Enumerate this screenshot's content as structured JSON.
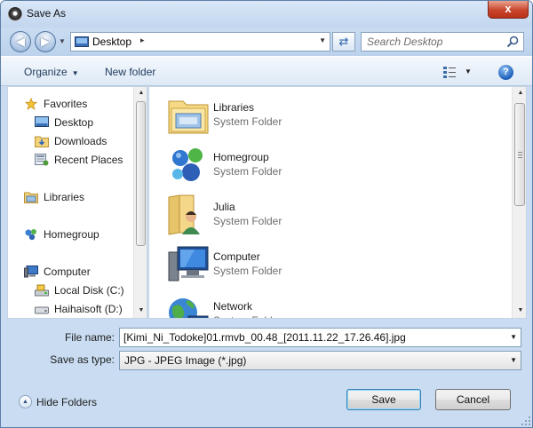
{
  "window": {
    "title": "Save As",
    "close_label": "x"
  },
  "address": {
    "location": "Desktop",
    "separator": "▸",
    "search_placeholder": "Search Desktop"
  },
  "toolbar": {
    "organize_label": "Organize",
    "new_folder_label": "New folder",
    "help_label": "?"
  },
  "navigation": {
    "favorites": {
      "label": "Favorites",
      "items": [
        "Desktop",
        "Downloads",
        "Recent Places"
      ]
    },
    "libraries": {
      "label": "Libraries"
    },
    "homegroup": {
      "label": "Homegroup"
    },
    "computer": {
      "label": "Computer",
      "items": [
        "Local Disk (C:)",
        "Haihaisoft (D:)"
      ]
    }
  },
  "content": {
    "items": [
      {
        "name": "Libraries",
        "type": "System Folder",
        "icon": "libraries-icon"
      },
      {
        "name": "Homegroup",
        "type": "System Folder",
        "icon": "homegroup-icon"
      },
      {
        "name": "Julia",
        "type": "System Folder",
        "icon": "user-folder-icon"
      },
      {
        "name": "Computer",
        "type": "System Folder",
        "icon": "computer-icon"
      },
      {
        "name": "Network",
        "type": "System Folder",
        "icon": "network-icon"
      }
    ]
  },
  "form": {
    "file_name_label": "File name:",
    "file_name_value": "[Kimi_Ni_Todoke]01.rmvb_00.48_[2011.11.22_17.26.46].jpg",
    "save_type_label": "Save as type:",
    "save_type_value": "JPG - JPEG Image (*.jpg)"
  },
  "footer": {
    "hide_folders_label": "Hide Folders",
    "save_label": "Save",
    "cancel_label": "Cancel"
  },
  "colors": {
    "chrome": "#c9dcf1",
    "accent": "#3c7fb1",
    "muted_text": "#6d6d6d"
  }
}
